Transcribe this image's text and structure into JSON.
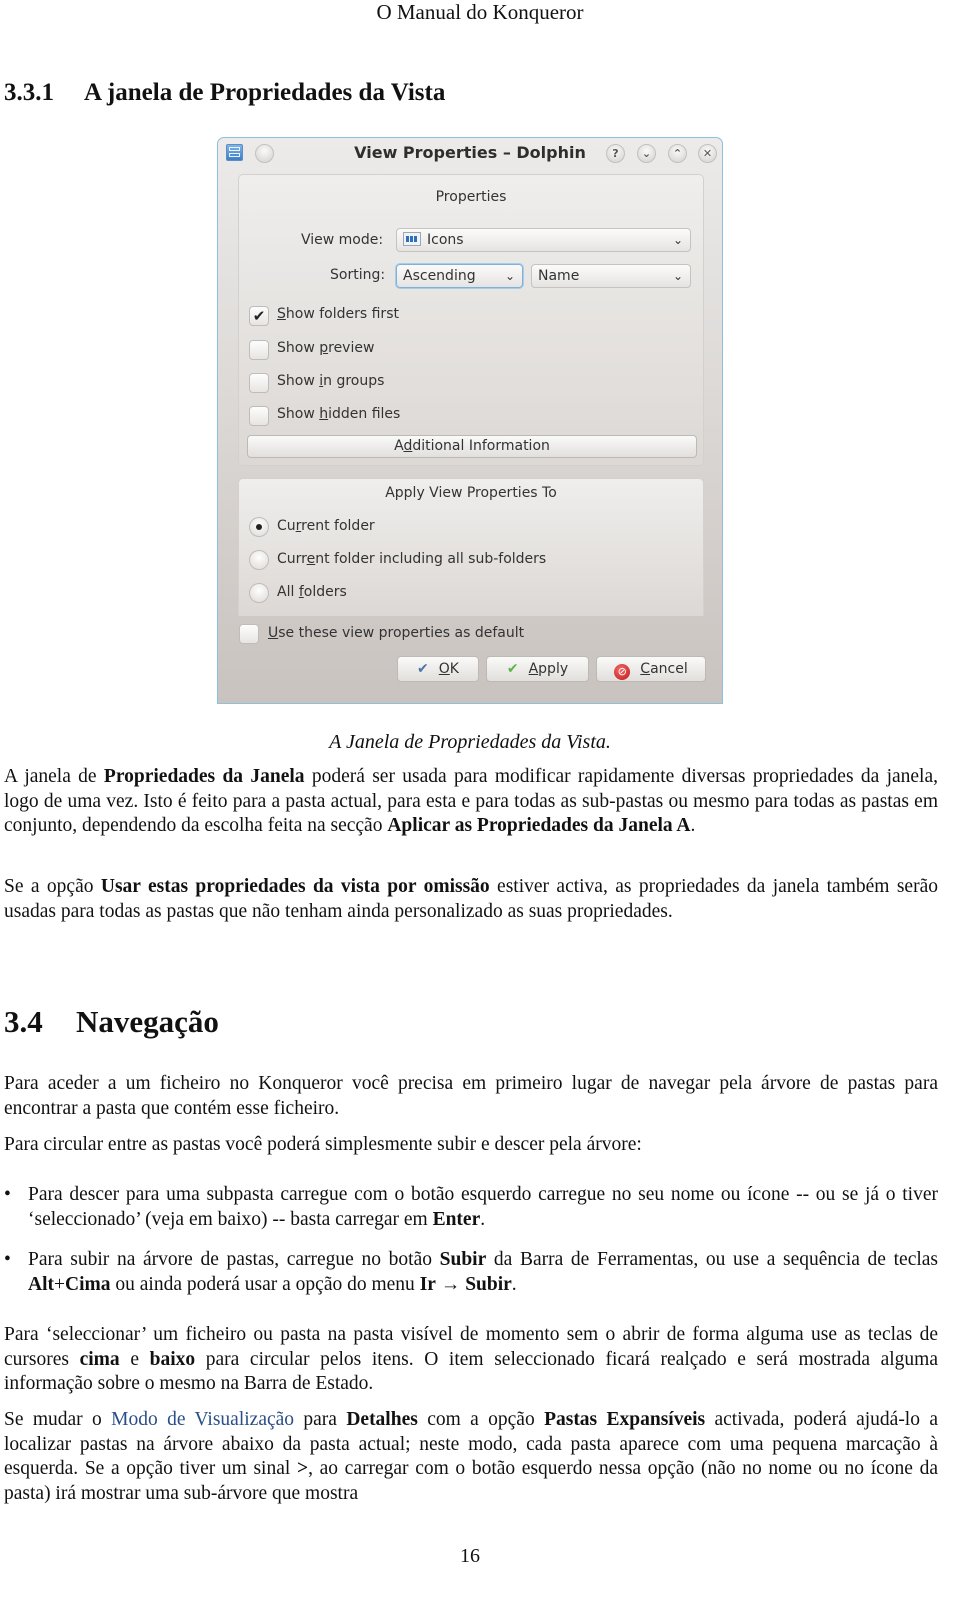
{
  "page": {
    "header": "O Manual do Konqueror",
    "page_number": "16"
  },
  "section_331": {
    "number": "3.3.1",
    "title": "A janela de Propriedades da Vista"
  },
  "dialog": {
    "title": "View Properties – Dolphin",
    "titlebar_buttons": {
      "help": "?",
      "minimize": "⌄",
      "maximize": "⌃",
      "close": "✕"
    },
    "properties_group": {
      "title": "Properties",
      "view_mode_label": "View mode:",
      "view_mode_value": "Icons",
      "sorting_label": "Sorting:",
      "sort_order_value": "Ascending",
      "sort_by_value": "Name",
      "checkboxes": [
        {
          "pre": "",
          "mnemonic": "S",
          "post": "how folders first",
          "checked": true
        },
        {
          "pre": "Show ",
          "mnemonic": "p",
          "post": "review",
          "checked": false
        },
        {
          "pre": "Show ",
          "mnemonic": "i",
          "post": "n groups",
          "checked": false
        },
        {
          "pre": "Show ",
          "mnemonic": "h",
          "post": "idden files",
          "checked": false
        }
      ],
      "checkmark_glyph": "✔",
      "additional_info_button": {
        "pre": "A",
        "mnemonic": "d",
        "post": "ditional Information"
      }
    },
    "apply_group": {
      "title": "Apply View Properties To",
      "radios": [
        {
          "pre": "Cu",
          "mnemonic": "r",
          "post": "rent folder",
          "selected": true
        },
        {
          "pre": "Curr",
          "mnemonic": "e",
          "post": "nt folder including all sub-folders",
          "selected": false
        },
        {
          "pre": "All ",
          "mnemonic": "f",
          "post": "olders",
          "selected": false
        }
      ]
    },
    "default_checkbox": {
      "pre": "",
      "mnemonic": "U",
      "post": "se these view properties as default",
      "checked": false
    },
    "buttons": {
      "ok": {
        "icon": "✔",
        "mnemonic": "O",
        "post": "K"
      },
      "apply": {
        "icon": "✔",
        "mnemonic": "A",
        "post": "pply"
      },
      "cancel": {
        "icon": "⊘",
        "mnemonic": "C",
        "post": "ancel"
      }
    },
    "chevron_glyph": "⌄"
  },
  "caption": "A Janela de Propriedades da Vista.",
  "para1": {
    "t1": "A janela de ",
    "b1": "Propriedades da Janela",
    "t2": " poderá ser usada para modificar rapidamente diversas propriedades da janela, logo de uma vez. Isto é feito para a pasta actual, para esta e para todas as sub-pastas ou mesmo para todas as pastas em conjunto, dependendo da escolha feita na secção ",
    "b2": "Aplicar as Propriedades da Janela A",
    "t3": "."
  },
  "para2": {
    "t1": "Se a opção ",
    "b1": "Usar estas propriedades da vista por omissão",
    "t2": " estiver activa, as propriedades da janela também serão usadas para todas as pastas que não tenham ainda personalizado as suas propriedades."
  },
  "section_34": {
    "number": "3.4",
    "title": "Navegação"
  },
  "para3": "Para aceder a um ficheiro no Konqueror você precisa em primeiro lugar de navegar pela árvore de pastas para encontrar a pasta que contém esse ficheiro.",
  "para4": "Para circular entre as pastas você poderá simplesmente subir e descer pela árvore:",
  "bullets": {
    "glyph": "•",
    "b1": {
      "t1": "Para descer para uma subpasta carregue com o botão esquerdo carregue no seu nome ou ícone -- ou se já o tiver ‘seleccionado’ (veja em baixo) -- basta carregar em ",
      "k1": "Enter",
      "t2": "."
    },
    "b2": {
      "t1": "Para subir na árvore de pastas, carregue no botão ",
      "k1": "Subir",
      "t2": "  da Barra de Ferramentas, ou use a sequência de teclas ",
      "k2": "Alt",
      "t3": "+",
      "k3": "Cima",
      "t4": " ou ainda poderá usar a opção do menu ",
      "k4": "Ir",
      "arrow": " → ",
      "k5": "Subir",
      "t5": "."
    }
  },
  "para5": {
    "t1": "Para ‘seleccionar’ um ficheiro ou pasta na pasta visível de momento sem o abrir de forma alguma use as teclas de cursores ",
    "k1": "cima",
    "t2": " e ",
    "k2": "baixo",
    "t3": "  para circular pelos itens. O item seleccionado ficará realçado e será mostrada alguma informação sobre o mesmo na Barra de Estado."
  },
  "para6": {
    "t1": "Se mudar o ",
    "link": "Modo de Visualização",
    "t2": " para ",
    "b1": "Detalhes",
    "t3": " com a opção ",
    "b2": "Pastas Expansíveis",
    "t4": " activada, poderá ajudá-lo a localizar pastas na árvore abaixo da pasta actual; neste modo, cada pasta aparece com uma pequena marcação à esquerda. Se a opção tiver um sinal ",
    "b3": ">",
    "t5": ", ao carregar com o botão esquerdo nessa opção (não no nome ou no ícone da pasta) irá mostrar uma sub-árvore que mostra"
  },
  "colors": {
    "link": "#2a4e87",
    "dialog_border": "#8fc0dc",
    "ok_icon": "#4a76a8",
    "apply_icon": "#5cb54a",
    "cancel_icon": "#c11616"
  }
}
